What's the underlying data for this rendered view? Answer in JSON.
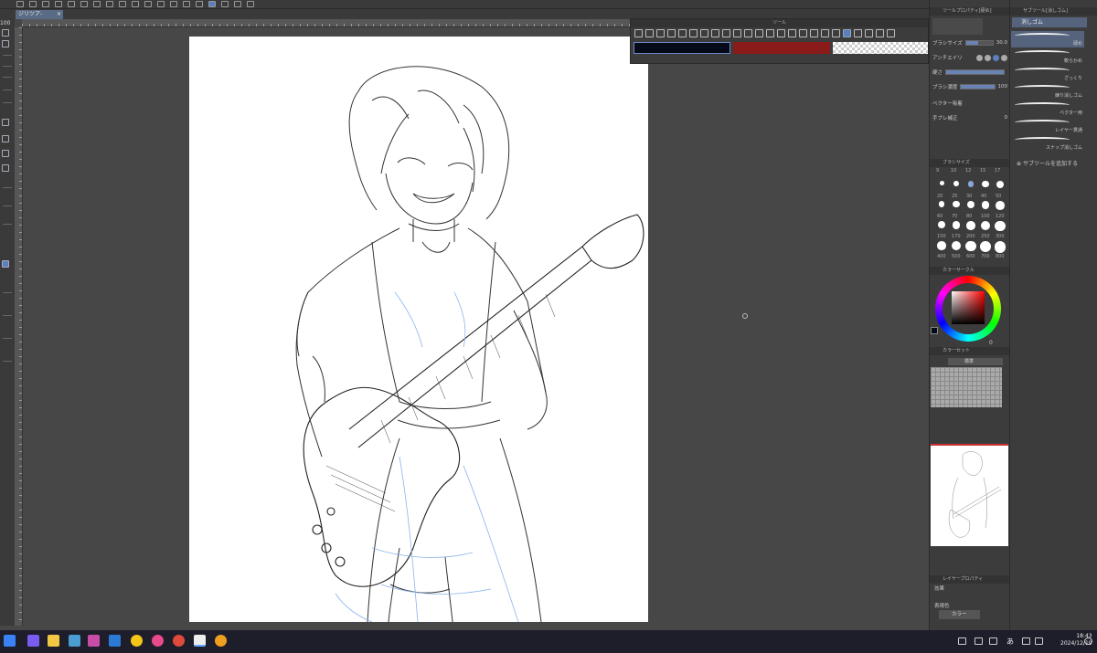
{
  "canvas": {
    "zoom": "100"
  },
  "document_tab": {
    "title": "ジリツア-",
    "close": "×"
  },
  "tool_window": {
    "title": "ツール"
  },
  "colors": {
    "main": "#050a18",
    "sub": "#8b1a1a",
    "accent": "#5b7fc0"
  },
  "tool_property": {
    "header": "ツールプロパティ[硬め]",
    "brush_size_label": "ブラシサイズ",
    "brush_size_value": "30.0",
    "antialias_label": "アンチエイリ",
    "hardness_label": "硬さ",
    "density_label": "ブラシ濃度",
    "density_value": "100",
    "vector_label": "ベクター吸着",
    "stabilization_label": "手ブレ補正",
    "stabilization_value": "0"
  },
  "brush_size_panel": {
    "header": "ブラシサイズ",
    "top_labels": [
      "9",
      "10",
      "12",
      "15",
      "17"
    ],
    "rows": [
      [
        "20",
        "25",
        "30",
        "40",
        "50"
      ],
      [
        "60",
        "70",
        "80",
        "100",
        "120"
      ],
      [
        "150",
        "170",
        "200",
        "250",
        "300"
      ],
      [
        "400",
        "500",
        "600",
        "700",
        "800"
      ]
    ]
  },
  "color_circle": {
    "header": "カラーサークル",
    "value_label": "0"
  },
  "color_set": {
    "header": "カラーセット",
    "set_name": "標準"
  },
  "layer_property": {
    "header": "レイヤープロパティ",
    "effect_label": "効果",
    "expression_label": "表現色",
    "expression_value": "カラー"
  },
  "sub_tool": {
    "header": "サブツール[消しゴム]",
    "active_tab": "消しゴム",
    "items": [
      {
        "label": "硬め"
      },
      {
        "label": "軟らかめ"
      },
      {
        "label": "ざっくり"
      },
      {
        "label": "練り消しゴム"
      },
      {
        "label": "ベクター用"
      },
      {
        "label": "レイヤー貫通"
      },
      {
        "label": "スナップ消しゴム"
      }
    ],
    "add_label": "サブツールを追加する"
  },
  "taskbar": {
    "ime": "あ",
    "time": "18:43",
    "date": "2024/12/19"
  }
}
